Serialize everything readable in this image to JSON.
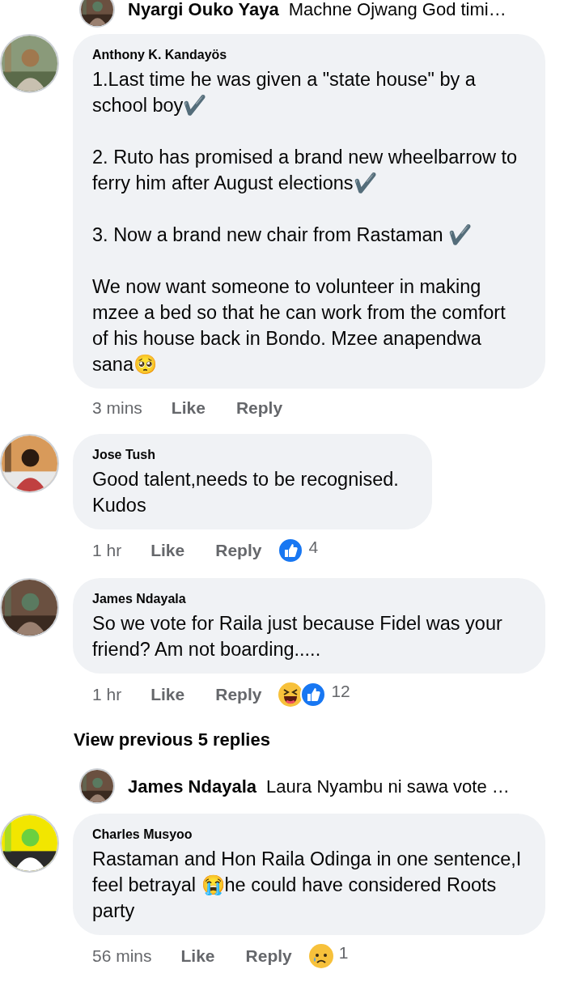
{
  "top_reply": {
    "author": "Nyargi Ouko Yaya",
    "preview": "Machne Ojwang God timi…"
  },
  "comments": [
    {
      "author": "Anthony K. Kandayös",
      "paragraphs": [
        "1.Last time he was given a \"state house\" by a school boy✔️",
        "2. Ruto has promised a brand new wheelbarrow to ferry him after August elections✔️",
        "3. Now a brand new chair from Rastaman ✔️",
        "We now want someone to volunteer in making mzee a bed so that he can work from the comfort of his house back in Bondo. Mzee anapendwa sana🥺"
      ],
      "time": "3 mins",
      "like": "Like",
      "reply": "Reply"
    },
    {
      "author": "Jose Tush",
      "paragraphs": [
        "Good talent,needs to be recognised. Kudos"
      ],
      "time": "1 hr",
      "like": "Like",
      "reply": "Reply",
      "reactions": [
        {
          "kind": "like"
        }
      ],
      "count": "4"
    },
    {
      "author": "James Ndayala",
      "paragraphs": [
        "So we vote for Raila just because Fidel was your friend? Am not boarding....."
      ],
      "time": "1 hr",
      "like": "Like",
      "reply": "Reply",
      "reactions": [
        {
          "kind": "haha"
        },
        {
          "kind": "like"
        }
      ],
      "count": "12"
    },
    {
      "kind": "more",
      "label": "View previous 5 replies"
    },
    {
      "kind": "collapsed",
      "author": "James Ndayala",
      "preview": "Laura Nyambu ni sawa vote …"
    },
    {
      "author": "Charles Musyoo",
      "paragraphs": [
        "Rastaman and Hon Raila Odinga in one sentence,I feel betrayal 😭he could have considered Roots party"
      ],
      "time": "56 mins",
      "like": "Like",
      "reply": "Reply",
      "reactions": [
        {
          "kind": "sad"
        }
      ],
      "count": "1"
    }
  ]
}
